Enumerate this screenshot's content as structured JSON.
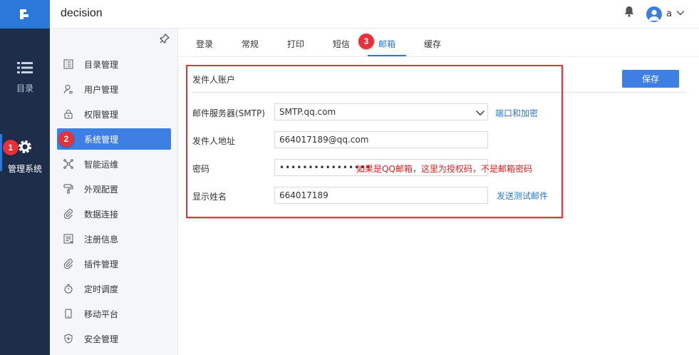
{
  "app": {
    "title": "decision"
  },
  "user": {
    "name": "a"
  },
  "rail": {
    "items": [
      {
        "label": "目录",
        "icon": "list-icon"
      },
      {
        "label": "管理系统",
        "icon": "gear-icon"
      }
    ]
  },
  "sidebar": {
    "items": [
      {
        "label": "目录管理"
      },
      {
        "label": "用户管理"
      },
      {
        "label": "权限管理"
      },
      {
        "label": "系统管理"
      },
      {
        "label": "智能运维"
      },
      {
        "label": "外观配置"
      },
      {
        "label": "数据连接"
      },
      {
        "label": "注册信息"
      },
      {
        "label": "插件管理"
      },
      {
        "label": "定时调度"
      },
      {
        "label": "移动平台"
      },
      {
        "label": "安全管理"
      }
    ]
  },
  "tabs": [
    {
      "label": "登录"
    },
    {
      "label": "常规"
    },
    {
      "label": "打印"
    },
    {
      "label": "短信"
    },
    {
      "label": "邮箱"
    },
    {
      "label": "缓存"
    }
  ],
  "form": {
    "section_title": "发件人账户",
    "save_label": "保存",
    "smtp": {
      "label": "邮件服务器(SMTP)",
      "value": "SMTP.qq.com",
      "link": "端口和加密"
    },
    "sender": {
      "label": "发件人地址",
      "value": "664017189@qq.com"
    },
    "password": {
      "label": "密码",
      "value": "••••••••••••••••",
      "note": "如果是QQ邮箱，这里为授权码，不是邮箱密码"
    },
    "display_name": {
      "label": "显示姓名",
      "value": "664017189",
      "link": "发送测试邮件"
    }
  },
  "badges": {
    "one": "1",
    "two": "2",
    "three": "3"
  },
  "colors": {
    "accent": "#3e7fe3",
    "rail": "#1e2d4a",
    "annotation": "#d9383a"
  }
}
